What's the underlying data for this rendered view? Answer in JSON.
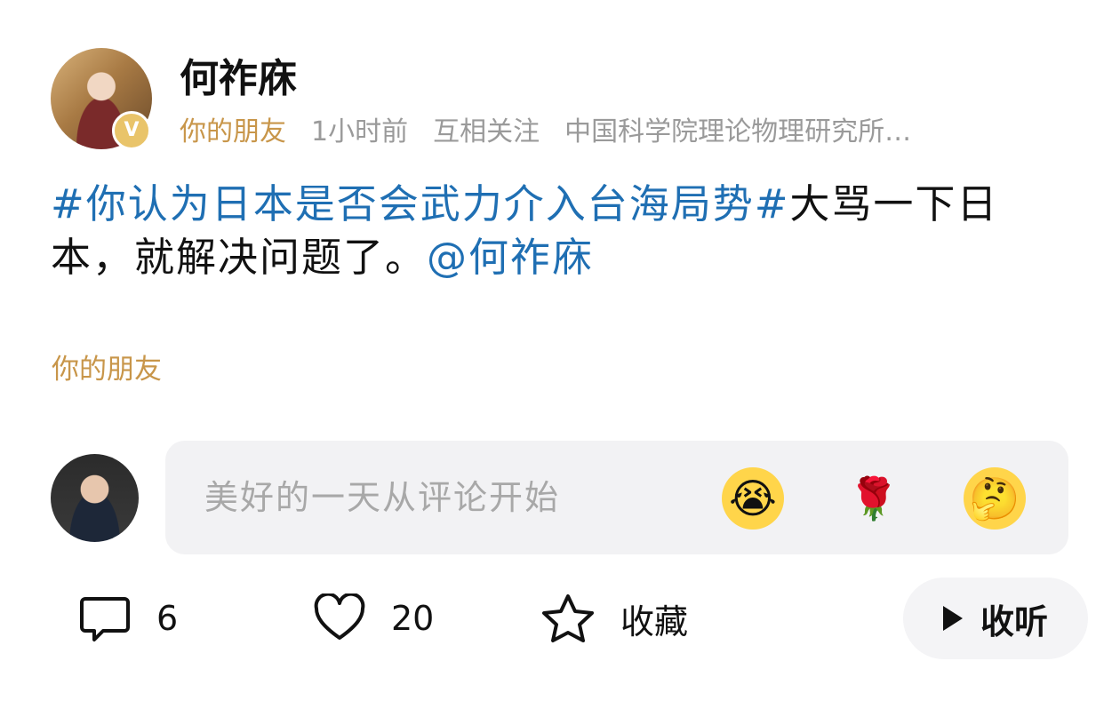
{
  "post": {
    "author": {
      "name": "何祚庥",
      "verified_icon": "v-badge-icon",
      "verified_label": "V"
    },
    "meta": {
      "friend_tag": "你的朋友",
      "time": "1小时前",
      "relationship": "互相关注",
      "affiliation": "中国科学院理论物理研究所…"
    },
    "content": {
      "topic": "#你认为日本是否会武力介入台海局势#",
      "text": "大骂一下日本，就解决问题了。",
      "mention": "@何祚庥"
    },
    "footer_tag": "你的朋友"
  },
  "comment_bar": {
    "placeholder": "美好的一天从评论开始",
    "emojis": [
      {
        "icon": "crying-slipper-emoji",
        "glyph": "😭"
      },
      {
        "icon": "rose-emoji",
        "glyph": "🌹"
      },
      {
        "icon": "thinking-emoji",
        "glyph": "🤔"
      }
    ]
  },
  "actions": {
    "comment_count": "6",
    "like_count": "20",
    "favorite_label": "收藏",
    "listen_label": "收听"
  },
  "colors": {
    "link_blue": "#1f6fb3",
    "friend_gold": "#c8964a",
    "meta_gray": "#9a9a9a"
  }
}
